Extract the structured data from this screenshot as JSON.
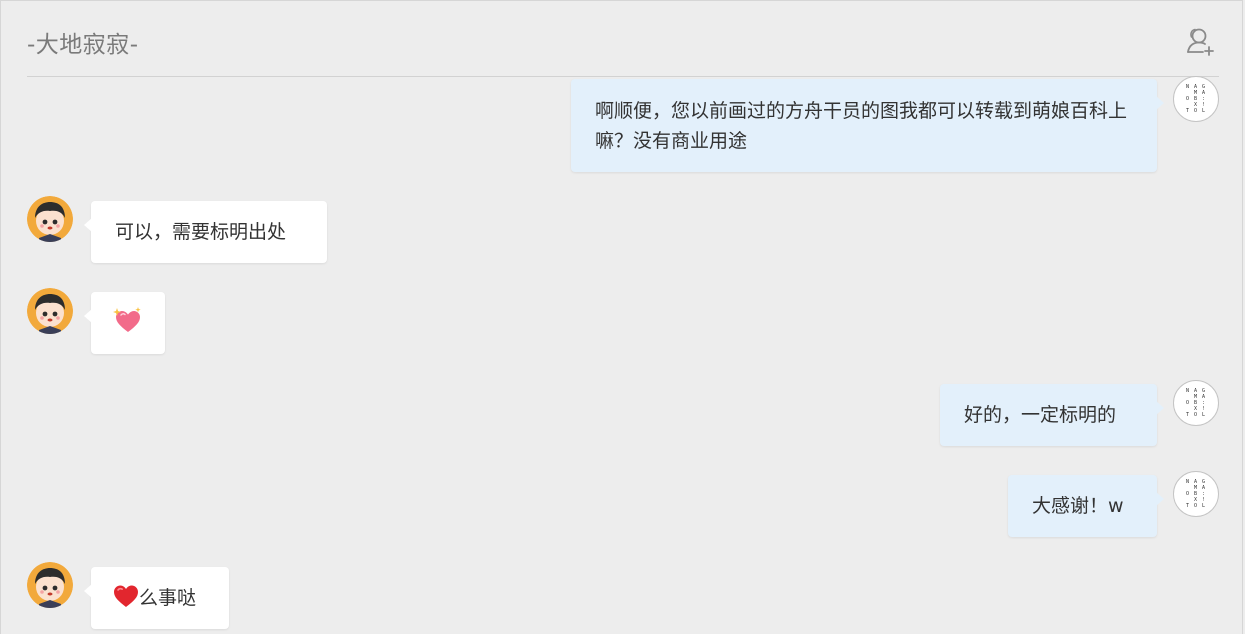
{
  "header": {
    "title": "-大地寂寂-"
  },
  "messages": [
    {
      "side": "right",
      "text": "啊顺便，您以前画过的方舟干员的图我都可以转载到萌娘百科上嘛？没有商业用途"
    },
    {
      "side": "left",
      "text": "可以，需要标明出处"
    },
    {
      "side": "left",
      "emoji": "sparkling-heart"
    },
    {
      "side": "right",
      "text": "好的，一定标明的"
    },
    {
      "side": "right",
      "text": "大感谢！w"
    },
    {
      "side": "left",
      "text": "么事哒",
      "emoji": "red-heart"
    }
  ],
  "icons": {
    "add_member": "add-member-icon",
    "self_avatar": "avatar-grid-icon",
    "peer_avatar": "cartoon-boy-avatar"
  },
  "colors": {
    "bubble_self": "#e3f0fb",
    "bubble_peer": "#ffffff",
    "background": "#ededed"
  }
}
